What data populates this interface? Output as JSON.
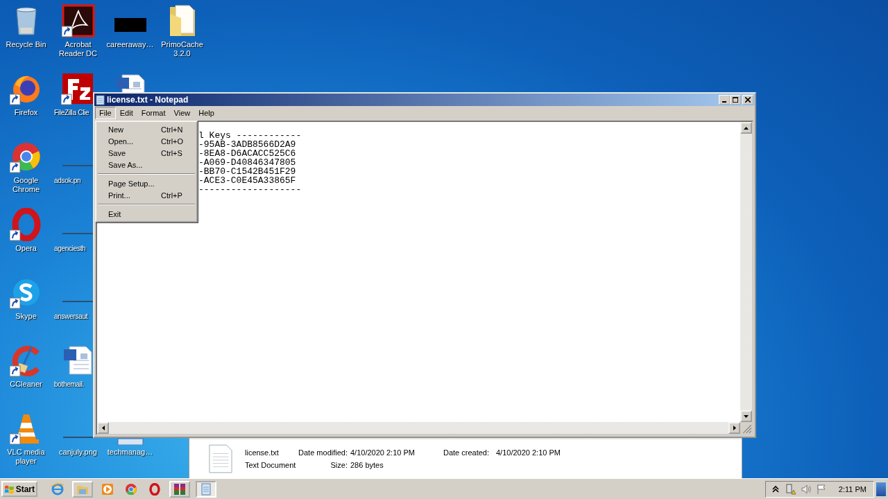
{
  "desktop_icons": [
    {
      "label": "Recycle Bin",
      "kind": "recycle-bin",
      "shortcut_arrow": false
    },
    {
      "label": "Firefox",
      "kind": "firefox",
      "shortcut_arrow": true
    },
    {
      "label": "Google Chrome",
      "kind": "chrome",
      "shortcut_arrow": true
    },
    {
      "label": "Opera",
      "kind": "opera",
      "shortcut_arrow": true
    },
    {
      "label": "Skype",
      "kind": "skype",
      "shortcut_arrow": true
    },
    {
      "label": "CCleaner",
      "kind": "ccleaner",
      "shortcut_arrow": true
    },
    {
      "label": "VLC media player",
      "kind": "vlc",
      "shortcut_arrow": true
    },
    {
      "label": "Acrobat Reader DC",
      "kind": "acrobat",
      "shortcut_arrow": true
    },
    {
      "label": "FileZilla Clie",
      "kind": "filezilla",
      "shortcut_arrow": true
    },
    {
      "label": "adsok.pn",
      "kind": "image",
      "shortcut_arrow": false
    },
    {
      "label": "agenciesth",
      "kind": "image",
      "shortcut_arrow": false
    },
    {
      "label": "answersaut",
      "kind": "image",
      "shortcut_arrow": false
    },
    {
      "label": "bothemail.",
      "kind": "word-doc",
      "shortcut_arrow": false
    },
    {
      "label": "canjuly.png",
      "kind": "image",
      "shortcut_arrow": false
    },
    {
      "label": "careeraway…",
      "kind": "black-image",
      "shortcut_arrow": false
    },
    {
      "kind": "word-doc"
    },
    {
      "label": "techmanag…",
      "kind": "image-card",
      "shortcut_arrow": false
    },
    {
      "label": "PrimoCache 3.2.0",
      "kind": "folder",
      "shortcut_arrow": false
    }
  ],
  "explorer_details": {
    "name": "license.txt",
    "type": "Text Document",
    "modified_label": "Date modified:",
    "modified": "4/10/2020 2:10 PM",
    "created_label": "Date created:",
    "created": "4/10/2020 2:10 PM",
    "size_label": "Size:",
    "size": "286 bytes"
  },
  "notepad": {
    "title": "license.txt - Notepad",
    "menus": [
      {
        "label": "File",
        "selected": true
      },
      {
        "label": "Edit",
        "selected": false
      },
      {
        "label": "Format",
        "selected": false
      },
      {
        "label": "View",
        "selected": false
      },
      {
        "label": "Help",
        "selected": false
      }
    ],
    "text_lines": [
      "l Keys ------------",
      "-95AB-3ADB8566D2A9",
      "-8EA8-D6ACACC525C6",
      "-A069-D40846347805",
      "-BB70-C1542B451F29",
      "-ACE3-C0E45A33865F",
      "-------------------"
    ],
    "file_menu": [
      {
        "kind": "item",
        "label": "New",
        "accelerator": "Ctrl+N"
      },
      {
        "kind": "item",
        "label": "Open...",
        "accelerator": "Ctrl+O"
      },
      {
        "kind": "item",
        "label": "Save",
        "accelerator": "Ctrl+S"
      },
      {
        "kind": "item",
        "label": "Save As..."
      },
      {
        "kind": "separator"
      },
      {
        "kind": "item",
        "label": "Page Setup..."
      },
      {
        "kind": "item",
        "label": "Print...",
        "accelerator": "Ctrl+P"
      },
      {
        "kind": "separator"
      },
      {
        "kind": "item",
        "label": "Exit"
      }
    ]
  },
  "taskbar": {
    "start": "Start",
    "apps": [
      {
        "kind": "ie",
        "running": false,
        "selected": false
      },
      {
        "kind": "explorer",
        "running": true,
        "selected": false
      },
      {
        "kind": "media-player",
        "running": false,
        "selected": false
      },
      {
        "kind": "chrome",
        "running": false,
        "selected": false
      },
      {
        "kind": "opera",
        "running": false,
        "selected": false
      },
      {
        "kind": "winrar",
        "running": true,
        "selected": false
      },
      {
        "kind": "notepad",
        "running": true,
        "selected": true
      }
    ],
    "tray": [
      {
        "kind": "chevron"
      },
      {
        "kind": "network-warning"
      },
      {
        "kind": "speaker"
      },
      {
        "kind": "flag"
      }
    ],
    "clock": "2:11 PM"
  }
}
